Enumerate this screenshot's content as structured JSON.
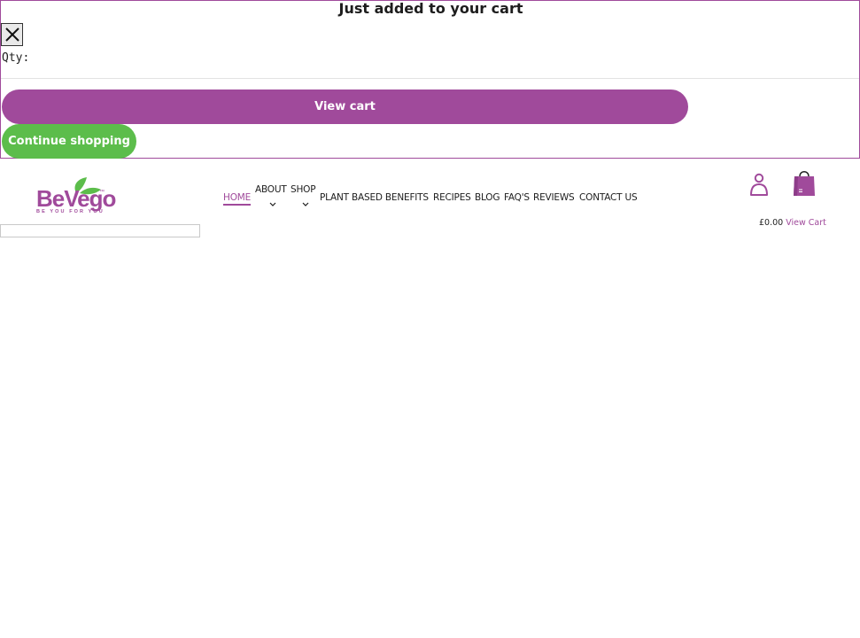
{
  "cart_popup": {
    "title": "Just added to your cart",
    "qty_label": "Qty:",
    "view_cart_label": "View cart",
    "continue_label": "Continue shopping"
  },
  "header": {
    "logo_text": "BeVego",
    "logo_tm": "™",
    "logo_tagline": "BE YOU FOR YOU",
    "nav": {
      "home": "HOME",
      "about": "ABOUT",
      "shop": "SHOP",
      "plant_based": "PLANT BASED BENEFITS",
      "recipes": "RECIPES",
      "blog": "BLOG",
      "faqs": "FAQ'S",
      "reviews": "REVIEWS",
      "contact": "CONTACT US"
    },
    "cart_amount": "£0.00",
    "cart_link": "View Cart"
  },
  "search": {
    "value": ""
  },
  "icons": {
    "close": "close-icon",
    "account": "account-icon",
    "bag": "shopping-bag-icon",
    "chevron": "chevron-down-icon",
    "leaf": "leaf-icon"
  },
  "colors": {
    "brand_purple": "#a04a9b",
    "brand_green": "#5cbd4b",
    "text": "#1d1d1d"
  }
}
